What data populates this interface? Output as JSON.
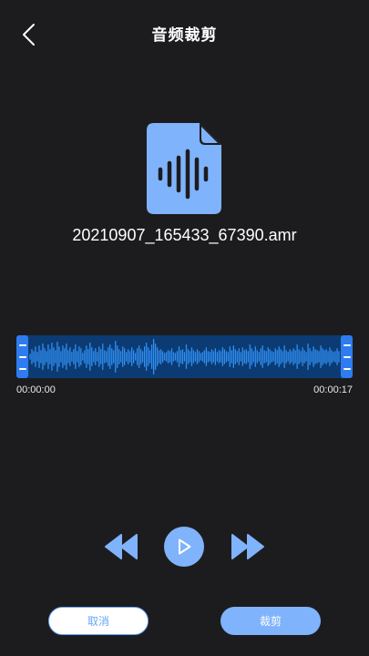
{
  "header": {
    "title": "音频裁剪",
    "back_icon": "chevron-left-icon"
  },
  "file": {
    "name": "20210907_165433_67390.amr",
    "icon": "audio-file-icon"
  },
  "waveform": {
    "start_time": "00:00:00",
    "end_time": "00:00:17",
    "bar_color": "#2f8ff3",
    "background_color": "#0c3b73",
    "handle_color": "#2e7cf0",
    "amplitudes": [
      0.15,
      0.4,
      0.3,
      0.55,
      0.25,
      0.6,
      0.35,
      0.7,
      0.45,
      0.3,
      0.65,
      0.4,
      0.75,
      0.5,
      0.35,
      0.8,
      0.55,
      0.3,
      0.6,
      0.45,
      0.7,
      0.35,
      0.5,
      0.25,
      0.4,
      0.65,
      0.3,
      0.55,
      0.45,
      0.2,
      0.35,
      0.6,
      0.4,
      0.75,
      0.5,
      0.3,
      0.45,
      0.25,
      0.55,
      0.4,
      0.7,
      0.35,
      0.3,
      0.5,
      0.65,
      0.45,
      0.35,
      0.85,
      0.6,
      0.4,
      0.3,
      0.55,
      0.45,
      0.25,
      0.4,
      0.3,
      0.5,
      0.35,
      0.2,
      0.45,
      0.6,
      0.4,
      0.3,
      0.55,
      0.75,
      0.5,
      0.35,
      0.65,
      0.95,
      0.7,
      0.5,
      0.35,
      0.4,
      0.3,
      0.2,
      0.25,
      0.35,
      0.3,
      0.45,
      0.25,
      0.2,
      0.3,
      0.55,
      0.35,
      0.4,
      0.25,
      0.65,
      0.4,
      0.3,
      0.5,
      0.35,
      0.25,
      0.4,
      0.3,
      0.2,
      0.25,
      0.35,
      0.5,
      0.3,
      0.25,
      0.4,
      0.3,
      0.45,
      0.25,
      0.35,
      0.3,
      0.5,
      0.4,
      0.3,
      0.25,
      0.55,
      0.35,
      0.6,
      0.4,
      0.3,
      0.45,
      0.25,
      0.5,
      0.35,
      0.4,
      0.3,
      0.65,
      0.45,
      0.3,
      0.55,
      0.35,
      0.25,
      0.45,
      0.6,
      0.35,
      0.3,
      0.5,
      0.4,
      0.3,
      0.25,
      0.45,
      0.35,
      0.55,
      0.4,
      0.3,
      0.6,
      0.35,
      0.25,
      0.4,
      0.3,
      0.45,
      0.35,
      0.65,
      0.4,
      0.3,
      0.5,
      0.35,
      0.25,
      0.7,
      0.45,
      0.3,
      0.55,
      0.4,
      0.35,
      0.3,
      0.6,
      0.45,
      0.35,
      0.4,
      0.3,
      0.5,
      0.35,
      0.25,
      0.3,
      0.45,
      0.3
    ]
  },
  "controls": {
    "rewind_icon": "rewind-icon",
    "play_icon": "play-icon",
    "forward_icon": "fast-forward-icon"
  },
  "actions": {
    "cancel_label": "取消",
    "crop_label": "裁剪"
  },
  "colors": {
    "accent": "#7fb3fb",
    "background": "#1c1c1e"
  }
}
